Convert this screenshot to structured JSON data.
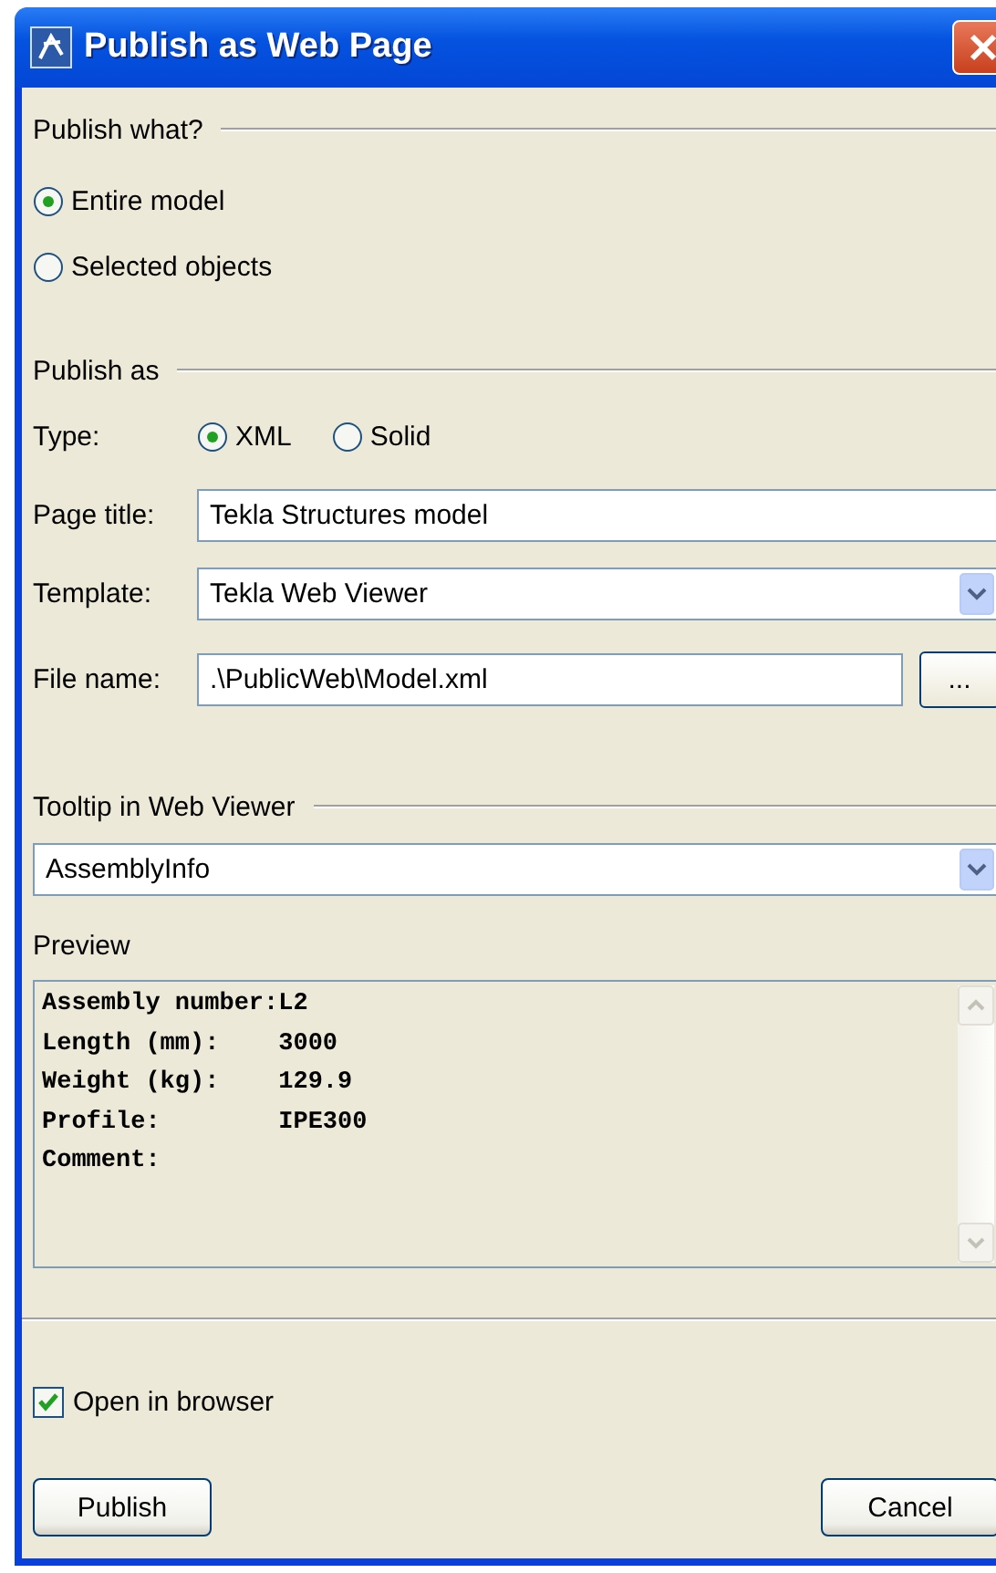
{
  "window": {
    "title": "Publish as Web Page"
  },
  "publish_what": {
    "label": "Publish what?",
    "options": [
      {
        "label": "Entire model",
        "selected": true
      },
      {
        "label": "Selected objects",
        "selected": false
      }
    ]
  },
  "publish_as": {
    "label": "Publish as",
    "type": {
      "label": "Type:",
      "options": [
        {
          "label": "XML",
          "selected": true
        },
        {
          "label": "Solid",
          "selected": false
        }
      ]
    },
    "page_title": {
      "label": "Page title:",
      "value": "Tekla Structures model"
    },
    "template": {
      "label": "Template:",
      "value": "Tekla Web Viewer"
    },
    "file_name": {
      "label": "File name:",
      "value": ".\\PublicWeb\\Model.xml",
      "browse_button": "..."
    }
  },
  "tooltip": {
    "label": "Tooltip in Web Viewer",
    "value": "AssemblyInfo"
  },
  "preview": {
    "label": "Preview",
    "lines": [
      "Assembly number:L2",
      "Length (mm):    3000",
      "Weight (kg):    129.9",
      "Profile:        IPE300",
      "Comment:"
    ]
  },
  "open_in_browser": {
    "label": "Open in browser",
    "checked": true
  },
  "buttons": [
    "Publish",
    "Cancel"
  ]
}
